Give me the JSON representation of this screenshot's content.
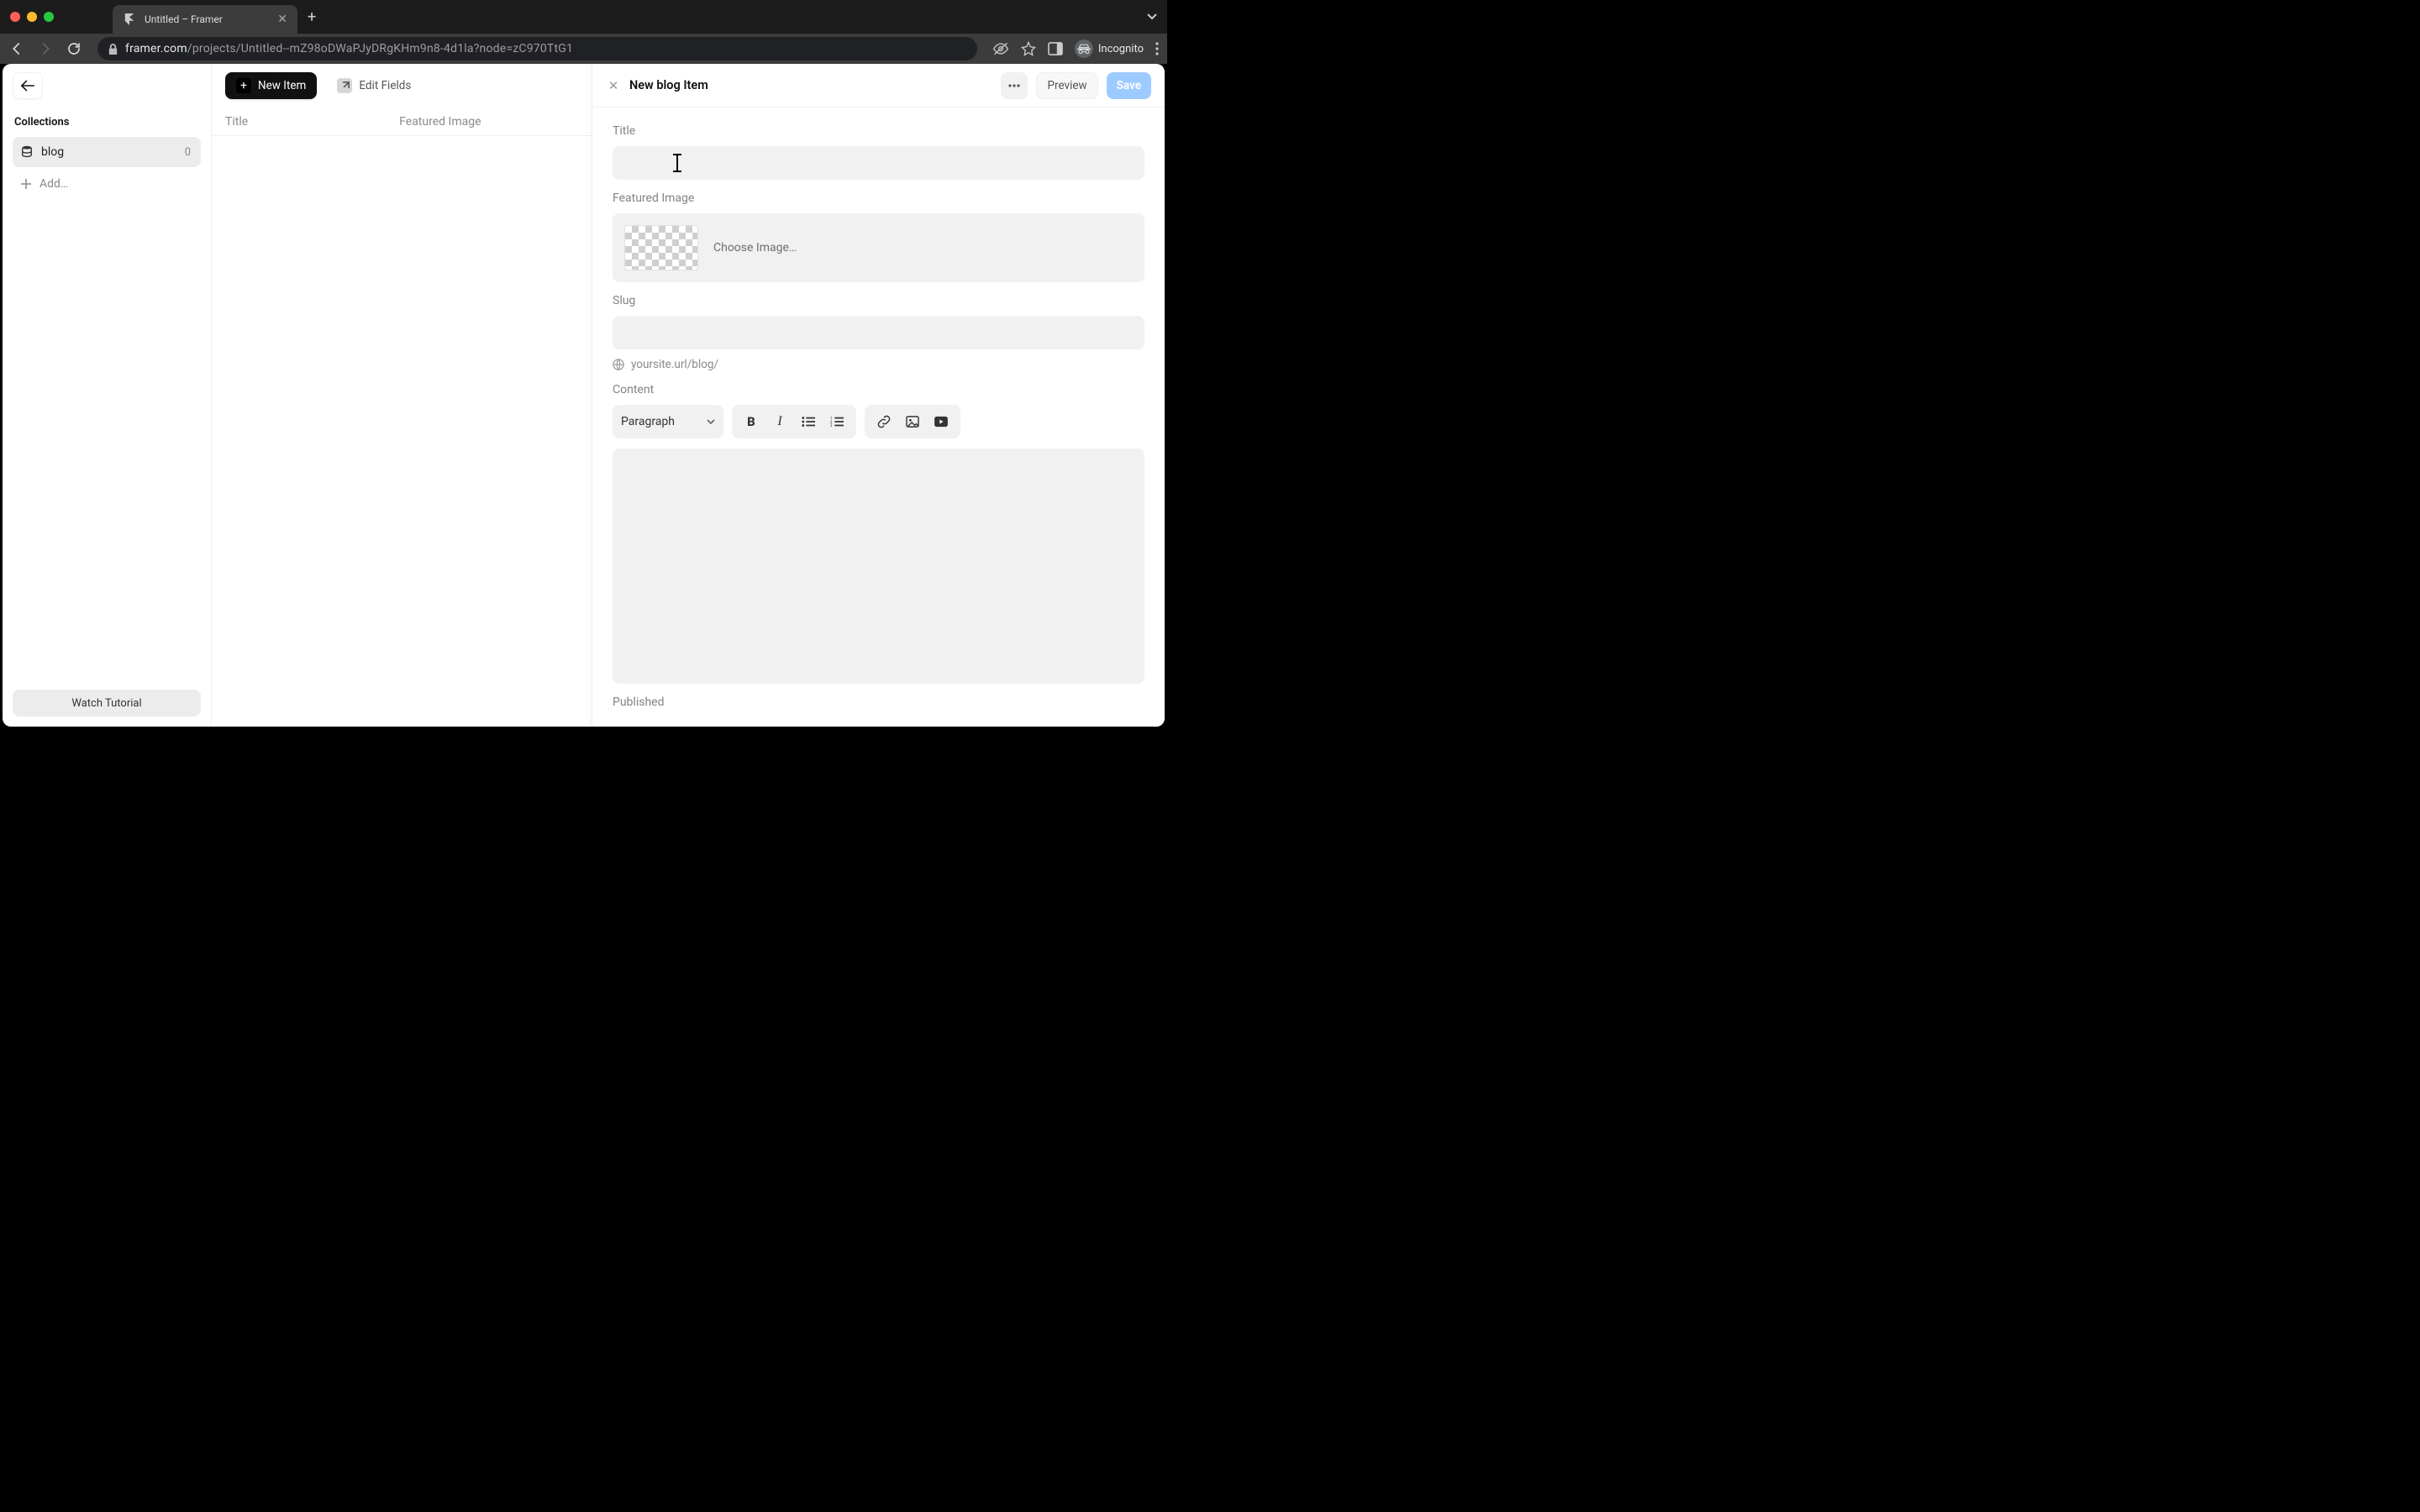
{
  "browser": {
    "tab_title": "Untitled – Framer",
    "url_host": "framer.com",
    "url_path": "/projects/Untitled--mZ98oDWaPJyDRgKHm9n8-4d1la?node=zC970TtG1",
    "incognito_label": "Incognito"
  },
  "sidebar": {
    "section_label": "Collections",
    "items": [
      {
        "name": "blog",
        "count": "0"
      }
    ],
    "add_label": "Add…",
    "tutorial_label": "Watch Tutorial"
  },
  "toolbar": {
    "new_item_label": "New Item",
    "edit_fields_label": "Edit Fields"
  },
  "table": {
    "columns": [
      "Title",
      "Featured Image"
    ]
  },
  "detail": {
    "title": "New blog Item",
    "preview_label": "Preview",
    "save_label": "Save",
    "fields": {
      "title_label": "Title",
      "title_value": "",
      "featured_image_label": "Featured Image",
      "choose_image_label": "Choose Image…",
      "slug_label": "Slug",
      "slug_value": "",
      "slug_hint": "yoursite.url/blog/",
      "content_label": "Content",
      "paragraph_label": "Paragraph",
      "published_label": "Published"
    }
  }
}
